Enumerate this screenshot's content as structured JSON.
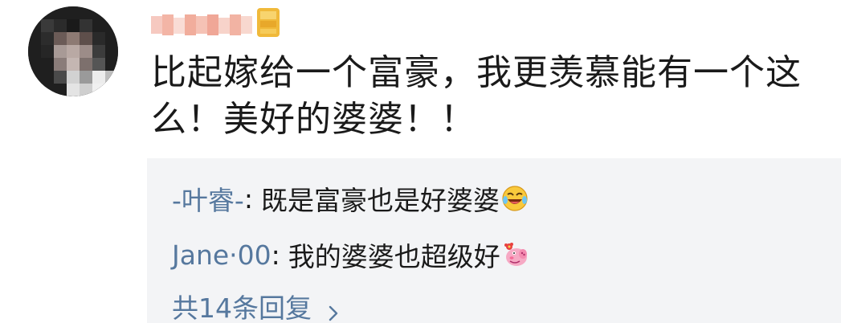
{
  "comment": {
    "text": "比起嫁给一个富豪，我更羡慕能有一个这么！美好的婆婆！！"
  },
  "replies": [
    {
      "author": "-叶睿-",
      "separator": ":",
      "text": "既是富豪也是好婆婆",
      "emoji": "laughing-crying-emoji"
    },
    {
      "author": "Jane·00",
      "separator": ":",
      "text": "我的婆婆也超级好",
      "emoji": "peppa-pig-emoji"
    }
  ],
  "more_replies": {
    "label": "共14条回复"
  },
  "colors": {
    "link": "#56789e",
    "reply_bg": "#f3f4f6",
    "text": "#1a1a1a",
    "vip_gold": "#f0b93a"
  }
}
